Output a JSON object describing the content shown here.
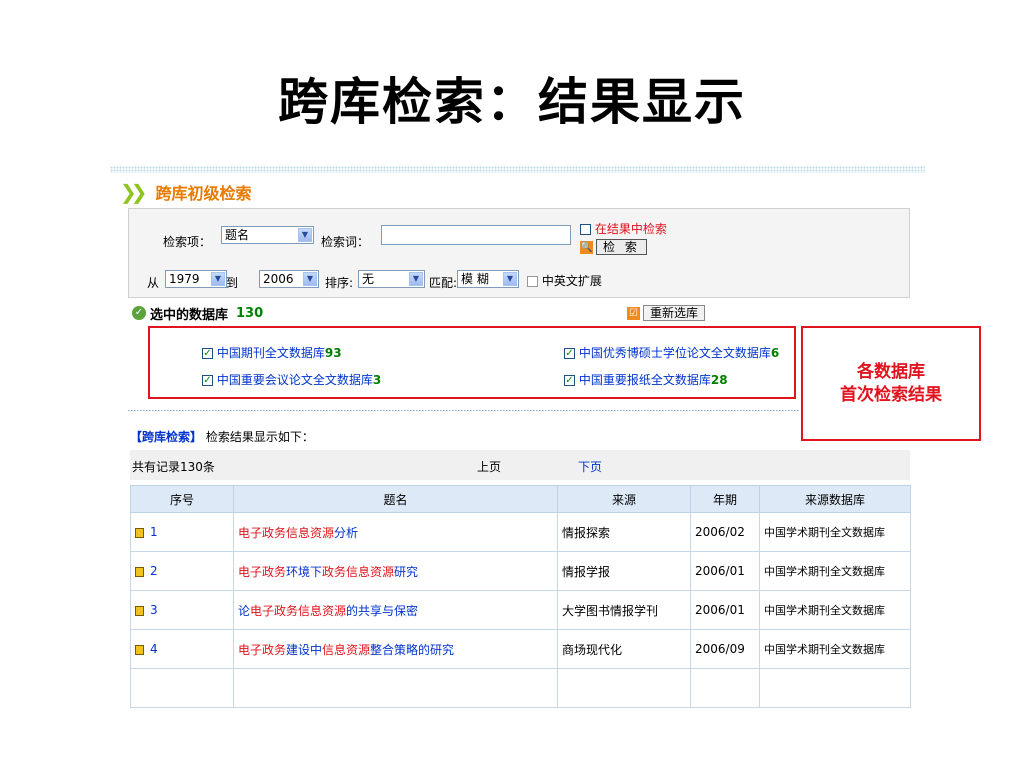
{
  "slide_title": "跨库检索：结果显示",
  "header": {
    "arrow": "❯❯",
    "title": "跨库初级检索"
  },
  "search": {
    "field_label": "检索项：",
    "field_value": "题名",
    "keyword_label": "检索词：",
    "keyword_value": "",
    "in_results_label": "在结果中检索",
    "search_button": "检 索",
    "from_label": "从",
    "from_year": "1979",
    "to_label": "到",
    "to_year": "2006",
    "sort_label": "排序:",
    "sort_value": "无",
    "match_label": "匹配:",
    "match_value": "模 糊",
    "expand_label": "中英文扩展"
  },
  "selected": {
    "label": "选中的数据库",
    "count": "130",
    "reselect_button": "重新选库"
  },
  "databases": [
    {
      "name": "中国期刊全文数据库",
      "count": "93"
    },
    {
      "name": "中国优秀博硕士学位论文全文数据库",
      "count": "6"
    },
    {
      "name": "中国重要会议论文全文数据库",
      "count": "3"
    },
    {
      "name": "中国重要报纸全文数据库",
      "count": "28"
    }
  ],
  "callout": {
    "line1": "各数据库",
    "line2": "首次检索结果"
  },
  "result_heading": {
    "tag": "【跨库检索】",
    "text": "检索结果显示如下："
  },
  "pager": {
    "total": "共有记录130条",
    "prev": "上页",
    "next": "下页"
  },
  "table": {
    "headers": [
      "序号",
      "题名",
      "来源",
      "年期",
      "来源数据库"
    ],
    "rows": [
      {
        "idx": "1",
        "title": [
          [
            "电子政务信息资源",
            "red"
          ],
          [
            "分析",
            "blue"
          ]
        ],
        "source": "情报探索",
        "issue": "2006/02",
        "db": "中国学术期刊全文数据库"
      },
      {
        "idx": "2",
        "title": [
          [
            "电子政务",
            "red"
          ],
          [
            "环境下",
            "blue"
          ],
          [
            "政务信息资源",
            "red"
          ],
          [
            "研究",
            "blue"
          ]
        ],
        "source": "情报学报",
        "issue": "2006/01",
        "db": "中国学术期刊全文数据库"
      },
      {
        "idx": "3",
        "title": [
          [
            "论",
            "blue"
          ],
          [
            "电子政务信息资源",
            "red"
          ],
          [
            "的共享与保密",
            "blue"
          ]
        ],
        "source": "大学图书情报学刊",
        "issue": "2006/01",
        "db": "中国学术期刊全文数据库"
      },
      {
        "idx": "4",
        "title": [
          [
            "电子政务",
            "red"
          ],
          [
            "建设中",
            "blue"
          ],
          [
            "信息资源",
            "red"
          ],
          [
            "整合策略的研究",
            "blue"
          ]
        ],
        "source": "商场现代化",
        "issue": "2006/09",
        "db": "中国学术期刊全文数据库"
      }
    ]
  },
  "colors": {
    "accent_red": "#e0141e",
    "link_blue": "#0033cc",
    "count_green": "#008000",
    "header_orange": "#e87a00",
    "table_header_bg": "#dde9f6"
  }
}
